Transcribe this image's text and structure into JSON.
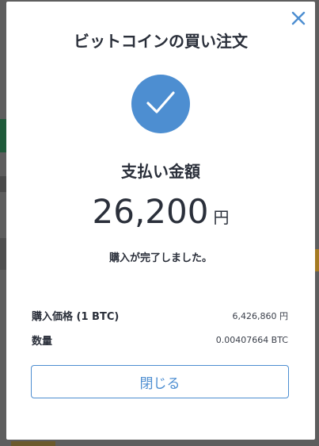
{
  "modal": {
    "title": "ビットコインの買い注文",
    "payment_label": "支払い金額",
    "amount": "26,200",
    "currency_unit": "円",
    "status_message": "購入が完了しました。",
    "details": [
      {
        "label": "購入価格 (1 BTC)",
        "value": "6,426,860 円"
      },
      {
        "label": "数量",
        "value": "0.00407664 BTC"
      }
    ],
    "close_button_label": "閉じる",
    "icons": {
      "close": "close-icon",
      "success": "check-icon"
    },
    "colors": {
      "accent": "#4d8ed1",
      "text": "#2a2f3a"
    }
  }
}
